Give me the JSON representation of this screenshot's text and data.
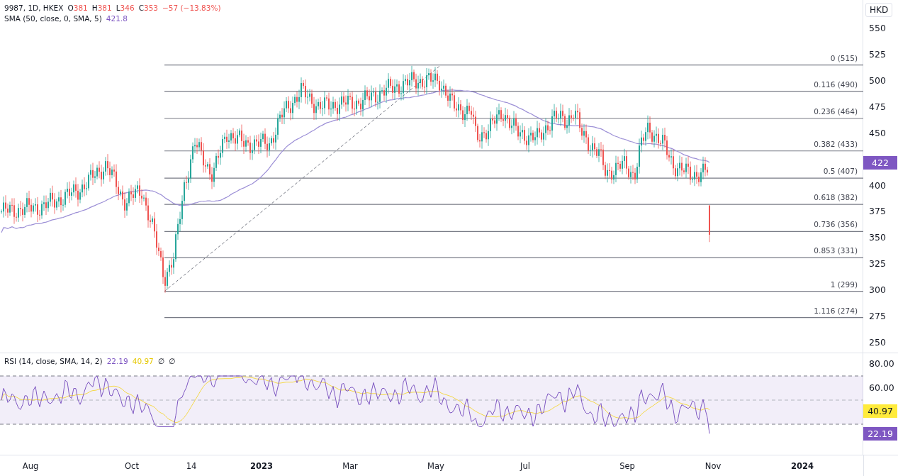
{
  "symbol_legend": {
    "title": "9987, 1D, HKEX",
    "ohlc": [
      {
        "label": "O",
        "value": "381"
      },
      {
        "label": "H",
        "value": "381"
      },
      {
        "label": "L",
        "value": "346"
      },
      {
        "label": "C",
        "value": "353"
      }
    ],
    "change": "−57 (−13.83%)"
  },
  "sma_legend": {
    "title": "SMA (50, close, 0, SMA, 5)",
    "value": "421.8"
  },
  "currency": "HKD",
  "price_axis": [
    "550",
    "525",
    "500",
    "475",
    "450",
    "400",
    "375",
    "350",
    "325",
    "300",
    "275",
    "250"
  ],
  "price_badge": "422",
  "fib_levels": [
    "0 (515)",
    "0.116 (490)",
    "0.236 (464)",
    "0.382 (433)",
    "0.5 (407)",
    "0.618 (382)",
    "0.736 (356)",
    "0.853 (331)",
    "1 (299)",
    "1.116 (274)"
  ],
  "rsi": {
    "title": "RSI (14, close, SMA, 14, 2)",
    "value": "22.19",
    "sma_value": "40.97",
    "extras": [
      "∅",
      "∅"
    ],
    "axis": [
      "80.00",
      "60.00"
    ],
    "sma_badge": "40.97",
    "rsi_badge": "22.19"
  },
  "time_axis": [
    {
      "label": "Aug",
      "bold": false
    },
    {
      "label": "Oct",
      "bold": false
    },
    {
      "label": "14",
      "bold": false
    },
    {
      "label": "2023",
      "bold": true
    },
    {
      "label": "Mar",
      "bold": false
    },
    {
      "label": "May",
      "bold": false
    },
    {
      "label": "Jul",
      "bold": false
    },
    {
      "label": "Sep",
      "bold": false
    },
    {
      "label": "Nov",
      "bold": false
    },
    {
      "label": "2024",
      "bold": true
    }
  ]
}
